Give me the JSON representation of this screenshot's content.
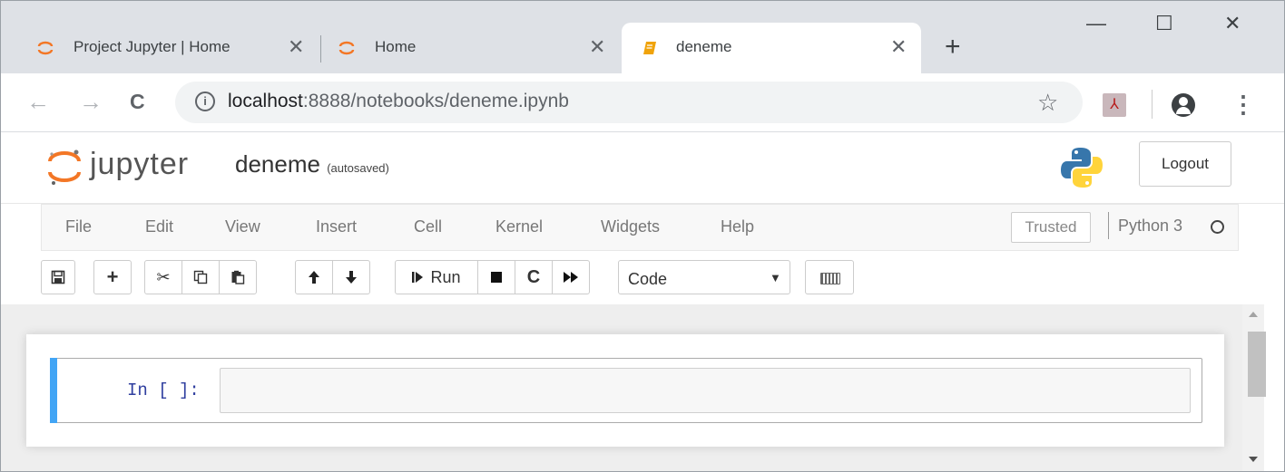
{
  "browser": {
    "tabs": [
      {
        "title": "Project Jupyter | Home",
        "icon": "jupyter-icon",
        "active": false
      },
      {
        "title": "Home",
        "icon": "jupyter-icon",
        "active": false
      },
      {
        "title": "deneme",
        "icon": "notebook-icon",
        "active": true
      }
    ],
    "close_glyph": "✕",
    "new_tab_glyph": "+",
    "window_controls": {
      "minimize": "—",
      "maximize": "☐",
      "close": "✕"
    },
    "nav": {
      "back": "←",
      "forward": "→",
      "reload": "C"
    },
    "url_host": "localhost",
    "url_rest": ":8888/notebooks/deneme.ipynb",
    "info_glyph": "i",
    "star_glyph": "☆",
    "pdf_ext_glyph": "⅄",
    "menu_glyph": "⋮"
  },
  "jupyter": {
    "logo_text": "jupyter",
    "notebook_name": "deneme",
    "autosave_status": "(autosaved)",
    "logout_label": "Logout",
    "menu_items": [
      "File",
      "Edit",
      "View",
      "Insert",
      "Cell",
      "Kernel",
      "Widgets",
      "Help"
    ],
    "trusted_label": "Trusted",
    "kernel_name": "Python 3",
    "kernel_status": "idle",
    "toolbar": {
      "save_glyph": "🖫",
      "add_glyph": "+",
      "cut_glyph": "✂",
      "copy_glyph": "⎘",
      "paste_glyph": "📋",
      "up_glyph": "🡩",
      "down_glyph": "🡫",
      "run_label": "Run",
      "run_glyph": "⏵",
      "stop_glyph": "■",
      "restart_glyph": "C",
      "fastforward_glyph": "⏩",
      "cell_type": "Code",
      "caret": "▼"
    },
    "cell": {
      "prompt": "In [ ]:",
      "content": ""
    }
  },
  "colors": {
    "tab_strip": "#dee1e6",
    "cell_selected_bar": "#42a5f5",
    "prompt": "#303f9f",
    "notebook_bg": "#eeeeee",
    "jupyter_orange": "#f37726"
  }
}
